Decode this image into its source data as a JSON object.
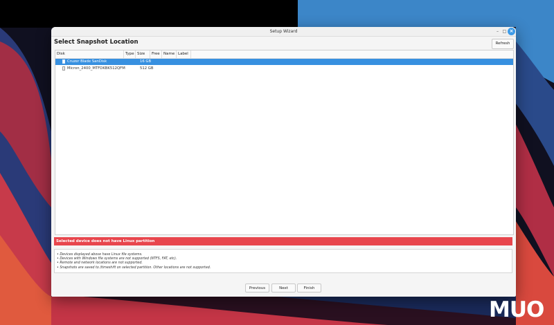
{
  "window": {
    "title": "Setup Wizard",
    "controls": {
      "minimize": "–",
      "maximize": "□",
      "close": "×"
    }
  },
  "page": {
    "heading": "Select Snapshot Location",
    "refresh_label": "Refresh"
  },
  "table": {
    "columns": [
      "Disk",
      "Type",
      "Size",
      "Free",
      "Name",
      "Label"
    ],
    "rows": [
      {
        "disk": "Cruzer Blade SanDisk",
        "size": "16 GB",
        "selected": true
      },
      {
        "disk": "Micron_2400_MTFDKBK512QFM",
        "size": "512 GB",
        "selected": false
      }
    ]
  },
  "error": "Selected device does not have Linux partition",
  "notes": [
    "• Devices displayed above have Linux file systems.",
    "• Devices with Windows file systems are not supported (NTFS, FAT, etc).",
    "• Remote and network locations are not supported.",
    "• Snapshots are saved to /timeshift on selected partition. Other locations are not supported."
  ],
  "nav": {
    "previous": "Previous",
    "next": "Next",
    "finish": "Finish"
  },
  "watermark": "MUO",
  "colors": {
    "accent": "#3790e0",
    "error": "#e8464d"
  }
}
